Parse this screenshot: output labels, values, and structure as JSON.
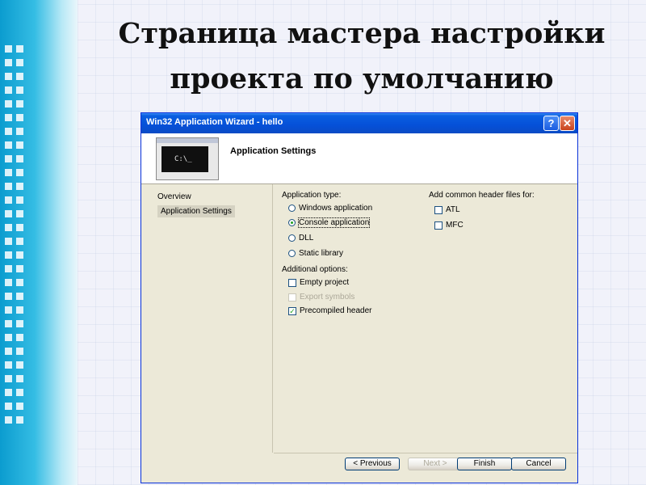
{
  "slide": {
    "title_line1": "Страница мастера  настройки",
    "title_line2": "проекта по умолчанию"
  },
  "window": {
    "title": "Win32 Application Wizard - hello",
    "help_button": "?",
    "close_button": "✕"
  },
  "header": {
    "title": "Application Settings",
    "console_text": "C:\\_"
  },
  "nav": {
    "items": [
      {
        "label": "Overview",
        "selected": false
      },
      {
        "label": "Application Settings",
        "selected": true
      }
    ]
  },
  "application_type": {
    "label": "Application type:",
    "options": [
      {
        "label": "Windows application",
        "selected": false
      },
      {
        "label": "Console application",
        "selected": true
      },
      {
        "label": "DLL",
        "selected": false
      },
      {
        "label": "Static library",
        "selected": false
      }
    ]
  },
  "additional_options": {
    "label": "Additional options:",
    "options": [
      {
        "label": "Empty project",
        "checked": false,
        "enabled": true
      },
      {
        "label": "Export symbols",
        "checked": false,
        "enabled": false
      },
      {
        "label": "Precompiled header",
        "checked": true,
        "enabled": true
      }
    ]
  },
  "common_headers": {
    "label": "Add common header files for:",
    "options": [
      {
        "label": "ATL",
        "checked": false
      },
      {
        "label": "MFC",
        "checked": false
      }
    ]
  },
  "buttons": {
    "previous": "< Previous",
    "next": "Next >",
    "finish": "Finish",
    "cancel": "Cancel"
  },
  "colors": {
    "titlebar": "#0550d8",
    "dialog_bg": "#ece9d8",
    "accent_check": "#21a121"
  }
}
